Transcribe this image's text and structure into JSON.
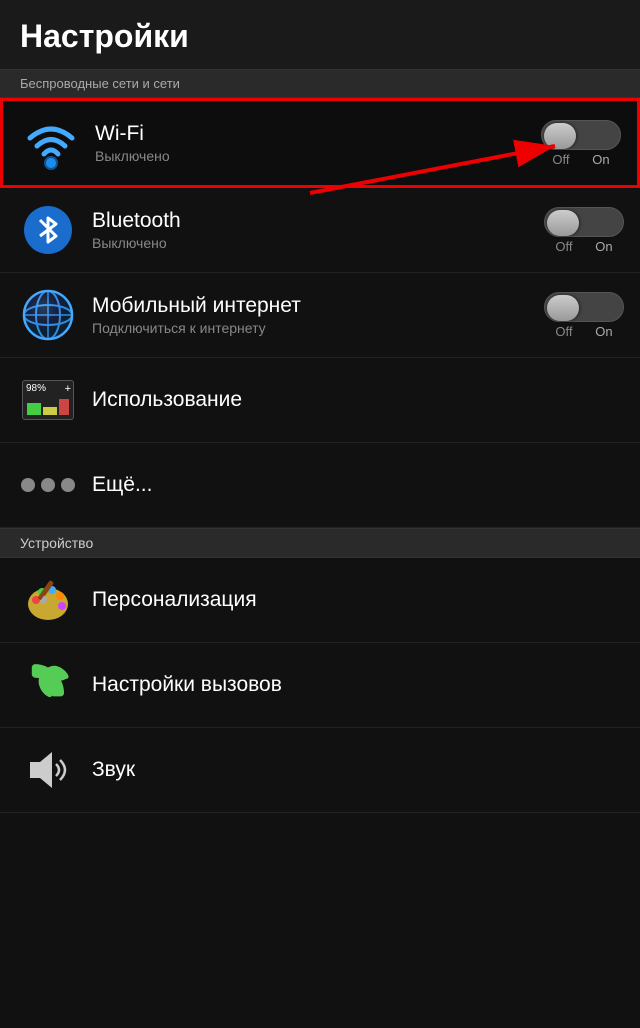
{
  "header": {
    "title": "Настройки"
  },
  "wireless_section": {
    "label": "Беспроводные сети и сети",
    "items": [
      {
        "id": "wifi",
        "title": "Wi-Fi",
        "subtitle": "Выключено",
        "toggle": {
          "state": "off",
          "label_off": "Off",
          "label_on": "On"
        },
        "highlighted": true
      },
      {
        "id": "bluetooth",
        "title": "Bluetooth",
        "subtitle": "Выключено",
        "toggle": {
          "state": "off",
          "label_off": "Off",
          "label_on": "On"
        },
        "highlighted": false
      },
      {
        "id": "mobile",
        "title": "Мобильный интернет",
        "subtitle": "Подключиться к интернету",
        "toggle": {
          "state": "off",
          "label_off": "Off",
          "label_on": "On"
        },
        "highlighted": false
      },
      {
        "id": "usage",
        "title": "Использование",
        "subtitle": "",
        "toggle": null,
        "highlighted": false
      },
      {
        "id": "more",
        "title": "Ещё...",
        "subtitle": "",
        "toggle": null,
        "highlighted": false
      }
    ]
  },
  "device_section": {
    "label": "Устройство",
    "items": [
      {
        "id": "personalization",
        "title": "Персонализация",
        "subtitle": ""
      },
      {
        "id": "calls",
        "title": "Настройки вызовов",
        "subtitle": ""
      },
      {
        "id": "sound",
        "title": "Звук",
        "subtitle": ""
      }
    ]
  }
}
